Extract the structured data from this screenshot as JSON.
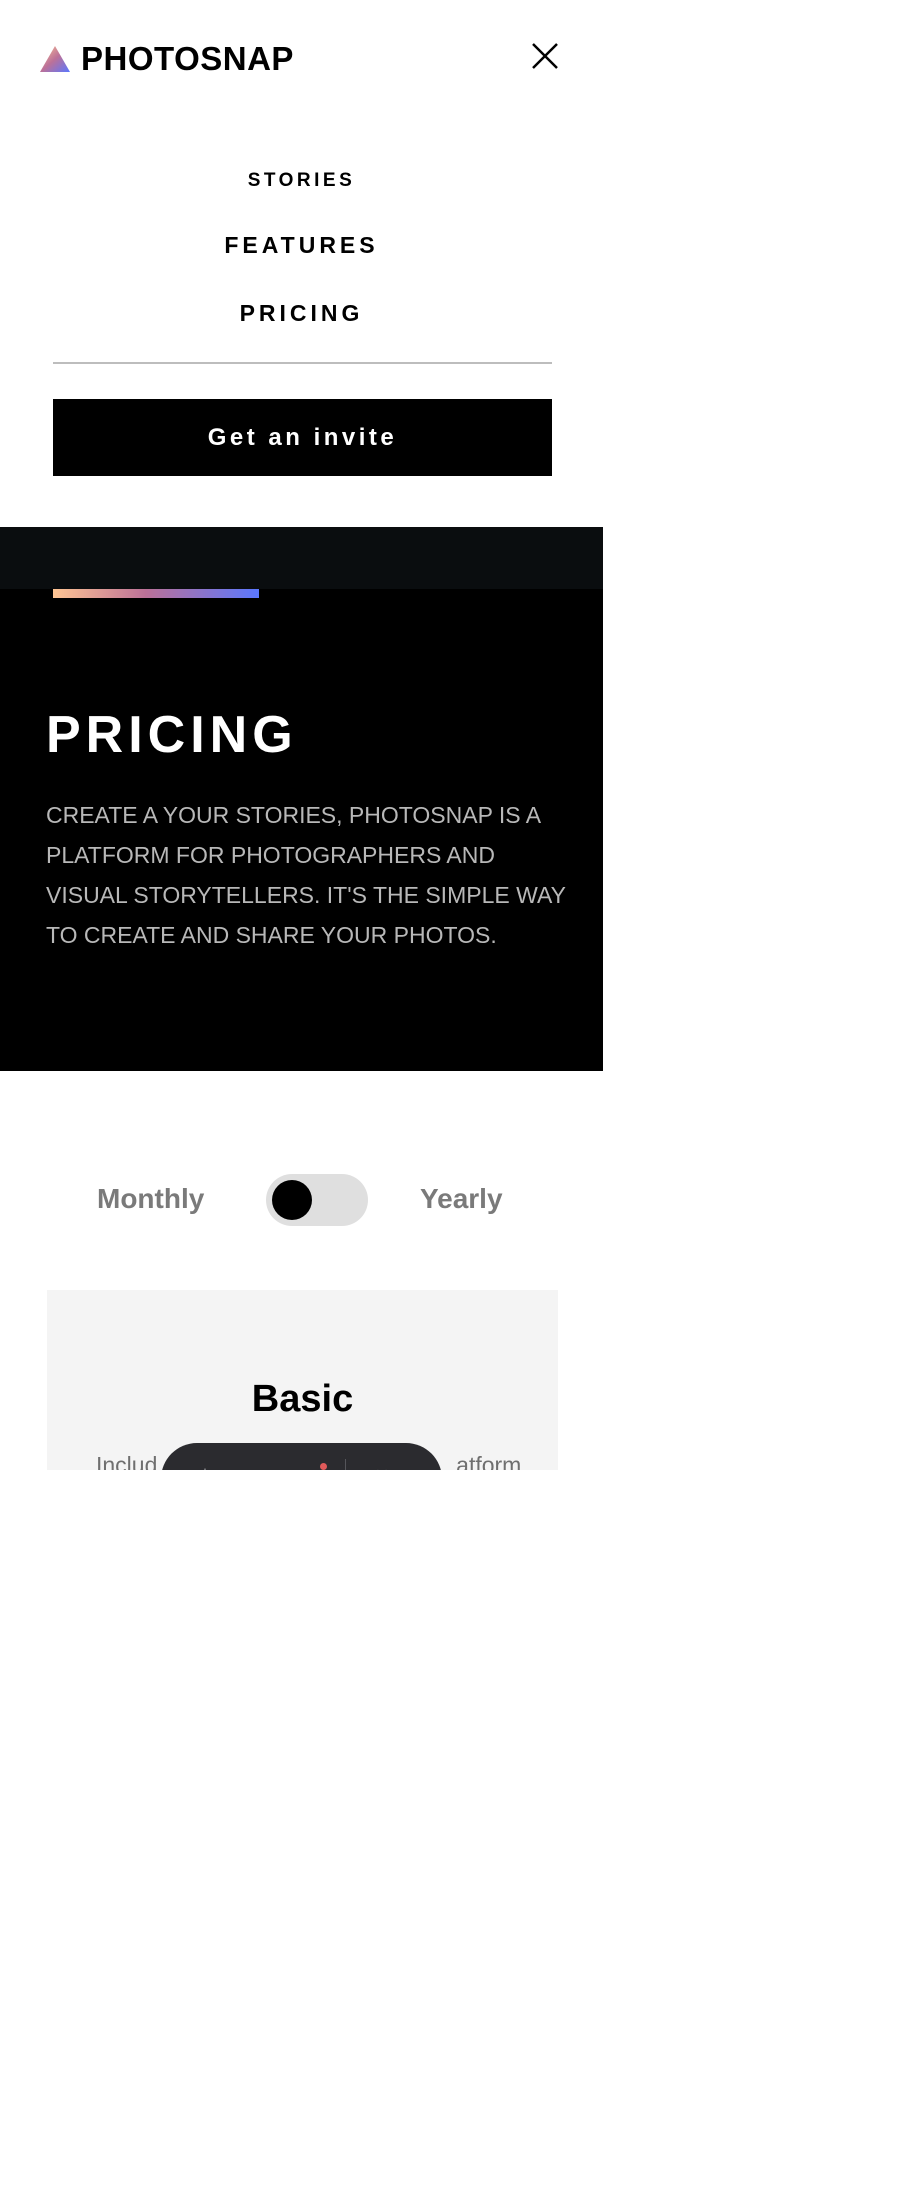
{
  "header": {
    "brand": "PHOTOSNAP",
    "logo_icon": "triangle-gradient-logo",
    "close_icon": "close-icon"
  },
  "nav": {
    "items": [
      {
        "label": "STORIES"
      },
      {
        "label": "FEATURES"
      },
      {
        "label": "PRICING"
      }
    ],
    "invite_label": "Get an invite"
  },
  "hero": {
    "title": "PRICING",
    "text": "CREATE A YOUR STORIES, PHOTOSNAP IS A PLATFORM FOR PHOTOGRAPHERS AND VISUAL STORYTELLERS. IT'S THE SIMPLE WAY TO CREATE AND SHARE YOUR PHOTOS.",
    "accent_colors": [
      "#ffc593",
      "#bc7198",
      "#5a77ff"
    ]
  },
  "billing": {
    "monthly_label": "Monthly",
    "yearly_label": "Yearly",
    "selected": "Monthly"
  },
  "plans": [
    {
      "name": "Basic",
      "description_visible": "Includ",
      "description_tail": "atform"
    }
  ],
  "dock": {
    "icons": [
      "text-icon",
      "hand-icon",
      "list-icon",
      "heart-icon"
    ]
  },
  "colors": {
    "background": "#ffffff",
    "hero_bg": "#000000",
    "card_bg": "#f4f4f4",
    "toggle_track": "#dfdfdf"
  }
}
